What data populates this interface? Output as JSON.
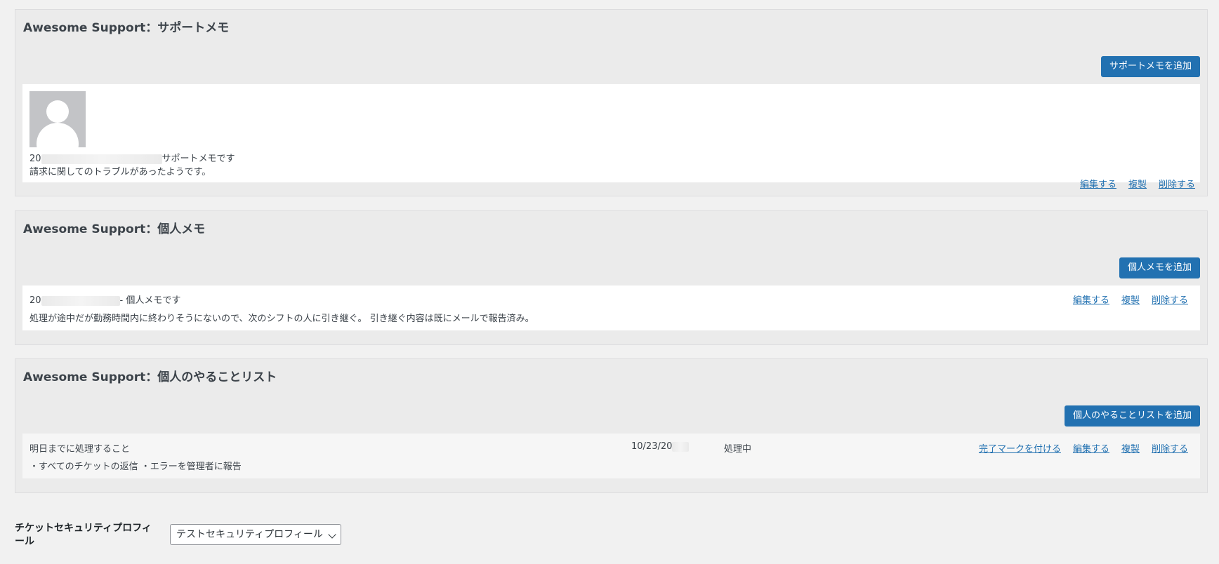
{
  "support_memo": {
    "title": "Awesome Support：サポートメモ",
    "add_button": "サポートメモを追加",
    "note": {
      "author_prefix": "20",
      "author_suffix": "サポートメモです",
      "body": "請求に関してのトラブルがあったようです。"
    },
    "actions": {
      "edit": "編集する",
      "duplicate": "複製",
      "delete": "削除する"
    }
  },
  "personal_memo": {
    "title": "Awesome Support：個人メモ",
    "add_button": "個人メモを追加",
    "note": {
      "author_prefix": "20",
      "author_suffix": "- 個人メモです",
      "body": "処理が途中だが勤務時間内に終わりそうにないので、次のシフトの人に引き継ぐ。 引き継ぐ内容は既にメールで報告済み。"
    },
    "actions": {
      "edit": "編集する",
      "duplicate": "複製",
      "delete": "削除する"
    }
  },
  "todo_list": {
    "title": "Awesome Support：個人のやることリスト",
    "add_button": "個人のやることリストを追加",
    "item": {
      "title": "明日までに処理すること",
      "date_prefix": "10/23/20",
      "status": "処理中",
      "body": "・すべてのチケットの返信 ・エラーを管理者に報告"
    },
    "actions": {
      "complete": "完了マークを付ける",
      "edit": "編集する",
      "duplicate": "複製",
      "delete": "削除する"
    }
  },
  "security_profile": {
    "label": "チケットセキュリティプロフィール",
    "selected": "テストセキュリティプロフィール"
  }
}
